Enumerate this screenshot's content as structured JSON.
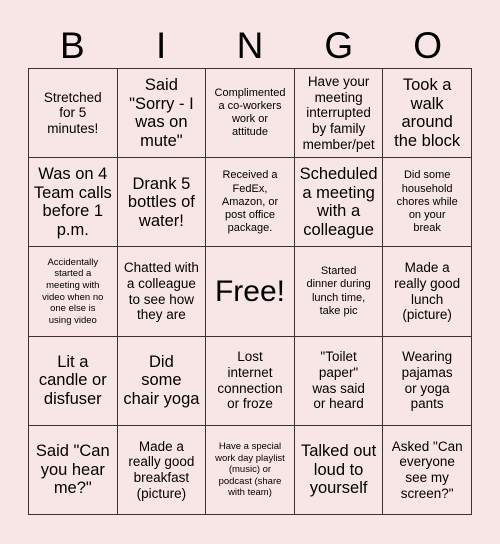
{
  "header": {
    "letters": [
      "B",
      "I",
      "N",
      "G",
      "O"
    ]
  },
  "grid": {
    "rows": [
      [
        {
          "text": "Stretched\nfor 5\nminutes!",
          "size": "fs-medium"
        },
        {
          "text": "Said\n\"Sorry - I\nwas on\nmute\"",
          "size": "fs-large"
        },
        {
          "text": "Complimented\na co-workers\nwork or\nattitude",
          "size": "fs-small"
        },
        {
          "text": "Have your\nmeeting\ninterrupted\nby family\nmember/pet",
          "size": "fs-medium"
        },
        {
          "text": "Took a\nwalk\naround\nthe block",
          "size": "fs-large"
        }
      ],
      [
        {
          "text": "Was on 4\nTeam calls\nbefore 1\np.m.",
          "size": "fs-large"
        },
        {
          "text": "Drank 5\nbottles of\nwater!",
          "size": "fs-large"
        },
        {
          "text": "Received a\nFedEx,\nAmazon, or\npost office\npackage.",
          "size": "fs-small"
        },
        {
          "text": "Scheduled\na meeting\nwith a\ncolleague",
          "size": "fs-large"
        },
        {
          "text": "Did some\nhousehold\nchores while\non your\nbreak",
          "size": "fs-small"
        }
      ],
      [
        {
          "text": "Accidentally\nstarted a\nmeeting with\nvideo when no\none else is\nusing video",
          "size": "fs-xsmall"
        },
        {
          "text": "Chatted with\na colleague\nto see how\nthey are",
          "size": "fs-medium"
        },
        {
          "text": "Free!",
          "size": "fs-free"
        },
        {
          "text": "Started\ndinner during\nlunch time,\ntake pic",
          "size": "fs-small"
        },
        {
          "text": "Made a\nreally good\nlunch\n(picture)",
          "size": "fs-medium"
        }
      ],
      [
        {
          "text": "Lit a\ncandle or\ndisfuser",
          "size": "fs-large"
        },
        {
          "text": "Did\nsome\nchair yoga",
          "size": "fs-large"
        },
        {
          "text": "Lost\ninternet\nconnection\nor froze",
          "size": "fs-medium"
        },
        {
          "text": "\"Toilet\npaper\"\nwas said\nor heard",
          "size": "fs-medium"
        },
        {
          "text": "Wearing\npajamas\nor yoga\npants",
          "size": "fs-medium"
        }
      ],
      [
        {
          "text": "Said \"Can\nyou hear\nme?\"",
          "size": "fs-large"
        },
        {
          "text": "Made a\nreally good\nbreakfast\n(picture)",
          "size": "fs-medium"
        },
        {
          "text": "Have a special\nwork day playlist\n(music) or\npodcast (share\nwith team)",
          "size": "fs-xsmall"
        },
        {
          "text": "Talked out\nloud to\nyourself",
          "size": "fs-large"
        },
        {
          "text": "Asked \"Can\neveryone\nsee my\nscreen?\"",
          "size": "fs-medium"
        }
      ]
    ]
  },
  "colors": {
    "background": "#f7e6e5",
    "grid_line": "#3c3234",
    "text": "#000000"
  }
}
